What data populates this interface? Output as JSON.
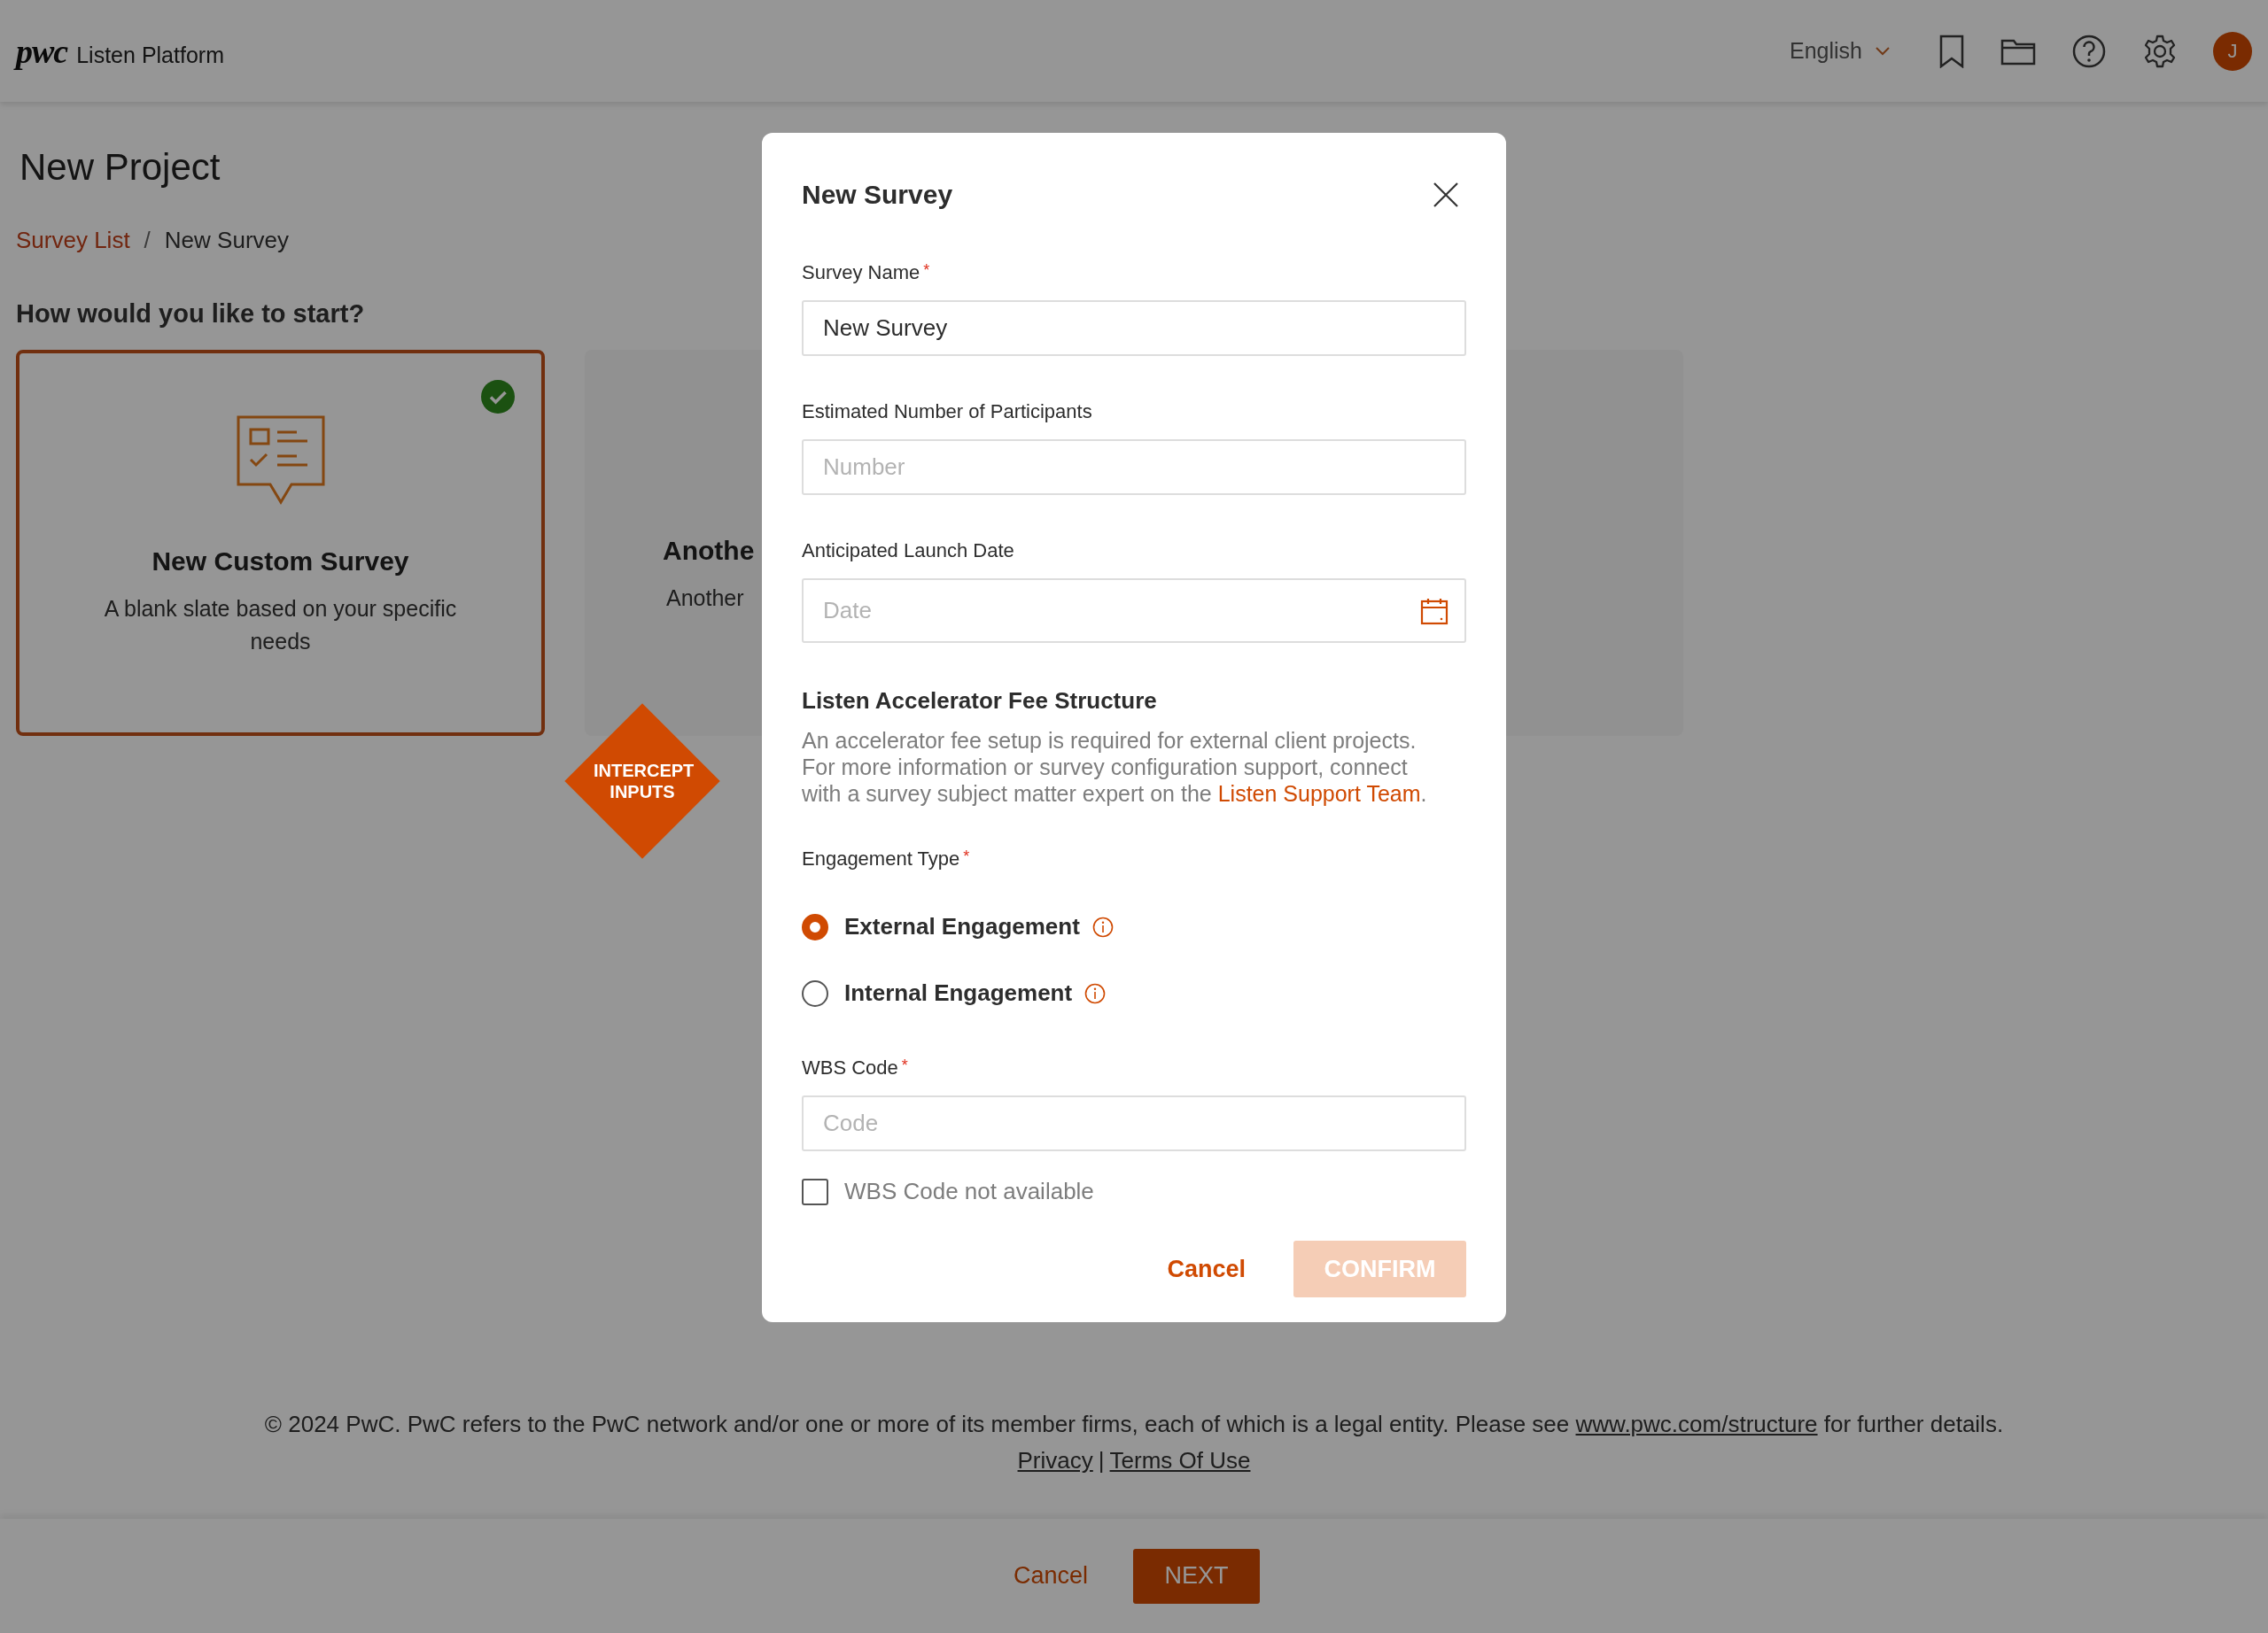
{
  "header": {
    "logo": "pwc",
    "app_name": "Listen Platform",
    "language": "English",
    "avatar_initial": "J"
  },
  "page": {
    "title": "New Project",
    "breadcrumb": [
      {
        "label": "Survey List",
        "kind": "link"
      },
      {
        "label": "/",
        "kind": "separator"
      },
      {
        "label": "New Survey",
        "kind": "current"
      }
    ],
    "prompt": "How would you like to start?",
    "options": [
      {
        "title": "New Custom Survey",
        "description": "A blank slate based on your specific needs",
        "selected": true,
        "kind": "custom"
      },
      {
        "title": "Anothe",
        "description": "Another",
        "selected": false,
        "kind": "cut"
      }
    ]
  },
  "badge": {
    "text": "INTERCEPT INPUTS"
  },
  "footer": {
    "text_before": "© 2024 PwC. PwC refers to the PwC network and/or one or more of its member firms, each of which is a legal entity. Please see",
    "link": "www.pwc.com/structure",
    "text_after": "for further details.",
    "links": [
      {
        "label": "Privacy",
        "kind": "link"
      },
      {
        "label": "|",
        "kind": "separator"
      },
      {
        "label": "Terms Of Use",
        "kind": "link"
      }
    ]
  },
  "actions": {
    "cancel": "Cancel",
    "next": "NEXT"
  },
  "dialog": {
    "title": "New Survey",
    "fields": [
      {
        "kind": "text",
        "label": "Survey Name",
        "required_mark": "*",
        "value": "New Survey"
      },
      {
        "kind": "text",
        "label": "Estimated Number of Participants",
        "placeholder": "Number"
      },
      {
        "kind": "date",
        "label": "Anticipated Launch Date",
        "placeholder": "Date"
      }
    ],
    "section_title": "Listen Accelerator Fee Structure",
    "section_text": "An accelerator fee setup is required for external client projects. For more information or survey configuration support, connect with a survey subject matter expert on the",
    "section_link": "Listen Support Team",
    "section_end": ".",
    "engagement": {
      "label": "Engagement Type",
      "required_mark": "*",
      "options": [
        {
          "label": "External Engagement",
          "selected": true
        },
        {
          "label": "Internal Engagement",
          "selected": false
        }
      ]
    },
    "wbs": {
      "label": "WBS Code",
      "required_mark": "*",
      "placeholder": "Code"
    },
    "wbs_unavailable": {
      "label": "WBS Code not available",
      "checked": false
    },
    "cancel": "Cancel",
    "confirm": {
      "label": "CONFIRM",
      "disabled": true
    }
  }
}
